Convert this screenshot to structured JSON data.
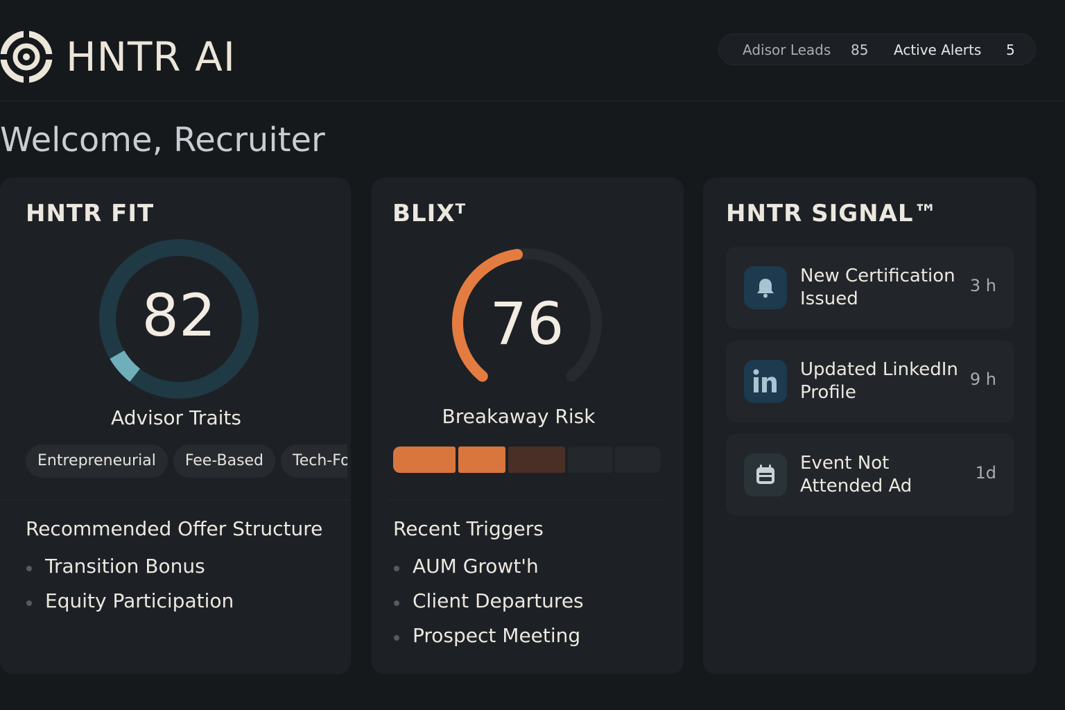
{
  "header": {
    "brand": "HNTR AI",
    "stats": {
      "leads_label": "Adisor Leads",
      "leads_value": "85",
      "alerts_label": "Active Alerts",
      "alerts_value": "5"
    }
  },
  "welcome": "Welcome, Recruiter",
  "fit_card": {
    "title": "HNTR FIT",
    "score": "82",
    "score_fraction": 0.82,
    "gauge_label": "Advisor Traits",
    "traits": [
      "Entrepreneurial",
      "Fee-Based",
      "Tech-Fo"
    ],
    "section_title": "Recommended Offer Structure",
    "offers": [
      "Transition Bonus",
      "Equity Participation"
    ],
    "colors": {
      "track": "#1f3a44",
      "accent": "#6faebb"
    }
  },
  "blix_card": {
    "title": "BLIXᵀ",
    "score": "76",
    "score_fraction": 0.76,
    "gauge_label": "Breakaway Risk",
    "risk_segments": [
      "#d8763e",
      "#d8763e",
      "#4a2f27",
      "#24282c",
      "#24282c"
    ],
    "section_title": "Recent Triggers",
    "triggers": [
      "AUM Growt'h",
      "Client Departures",
      "Prospect Meeting"
    ],
    "colors": {
      "track": "#272b2f",
      "accent": "#e47c41"
    }
  },
  "signal_card": {
    "title": "HNTR SIGNAL™",
    "items": [
      {
        "text": "New Certification Issued",
        "time": "3 h",
        "icon": "bell-icon",
        "icon_bg": "#1e3a4e"
      },
      {
        "text": "Updated LinkedIn Profile",
        "time": "9 h",
        "icon": "linkedin-icon",
        "icon_bg": "#1e3a4e"
      },
      {
        "text": "Event Not Attended Ad",
        "time": "1d",
        "icon": "calendar-icon",
        "icon_bg": "#2a3338"
      }
    ]
  }
}
